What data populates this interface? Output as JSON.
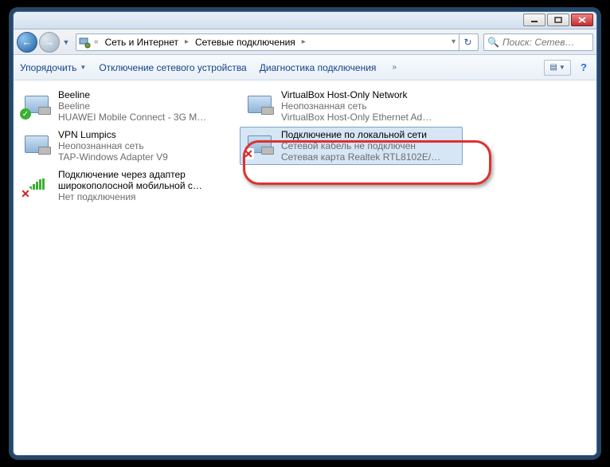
{
  "breadcrumbs": {
    "seg1": "Сеть и Интернет",
    "seg2": "Сетевые подключения"
  },
  "search": {
    "placeholder": "Поиск: Сетев…"
  },
  "toolbar": {
    "organize": "Упорядочить",
    "disable": "Отключение сетевого устройства",
    "diagnose": "Диагностика подключения"
  },
  "conn": [
    {
      "title": "Beeline",
      "sub1": "Beeline",
      "sub2": "HUAWEI Mobile Connect - 3G M…"
    },
    {
      "title": "VPN Lumpics",
      "sub1": "Неопознанная сеть",
      "sub2": "TAP-Windows Adapter V9"
    },
    {
      "title": "Подключение через адаптер широкополосной мобильной с…",
      "sub1": "",
      "sub2": "Нет подключения"
    },
    {
      "title": "VirtualBox Host-Only Network",
      "sub1": "Неопознанная сеть",
      "sub2": "VirtualBox Host-Only Ethernet Ad…"
    },
    {
      "title": "Подключение по локальной сети",
      "sub1": "Сетевой кабель не подключен",
      "sub2": "Сетевая карта Realtek RTL8102E/…"
    }
  ]
}
